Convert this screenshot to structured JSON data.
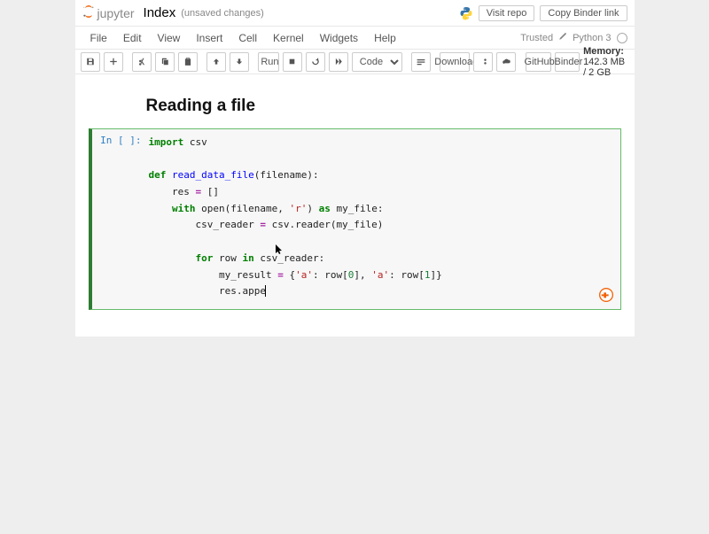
{
  "header": {
    "logo_text": "jupyter",
    "notebook_name": "Index",
    "status": "(unsaved changes)",
    "visit_repo": "Visit repo",
    "copy_binder": "Copy Binder link"
  },
  "menubar": {
    "items": [
      "File",
      "Edit",
      "View",
      "Insert",
      "Cell",
      "Kernel",
      "Widgets",
      "Help"
    ],
    "trusted": "Trusted",
    "kernel_name": "Python 3"
  },
  "toolbar": {
    "run_label": "Run",
    "download_label": "Download",
    "github_label": "GitHub",
    "binder_label": "Binder",
    "cell_type_value": "Code",
    "memory_label": "Memory:",
    "memory_value": "142.3 MB / 2 GB"
  },
  "notebook": {
    "heading": "Reading a file",
    "prompt": "In [ ]:",
    "code_tokens": {
      "import": "import",
      "csv": " csv",
      "def": "def",
      "fn": " read_data_file",
      "params": "(filename):",
      "res_line": "    res ",
      "eq": "=",
      "empty": " []",
      "with": "with",
      "open": " open(filename, ",
      "mode": "'r'",
      "as_kw": "as",
      "close_open": ") ",
      "my_file": " my_file:",
      "reader_line_a": "        csv_reader ",
      "reader_line_b": " csv.reader(my_file)",
      "for": "for",
      "row_in": " row ",
      "in": "in",
      "csv_reader": " csv_reader:",
      "myres_a": "            my_result ",
      "dict_open": " {",
      "key_a": "'a'",
      "row0a": ": row[",
      "zero": "0",
      "row0b": "], ",
      "key_b": "'a'",
      "row1a": ": row[",
      "one": "1",
      "row1b": "]}",
      "res_appe": "            res.appe"
    }
  }
}
